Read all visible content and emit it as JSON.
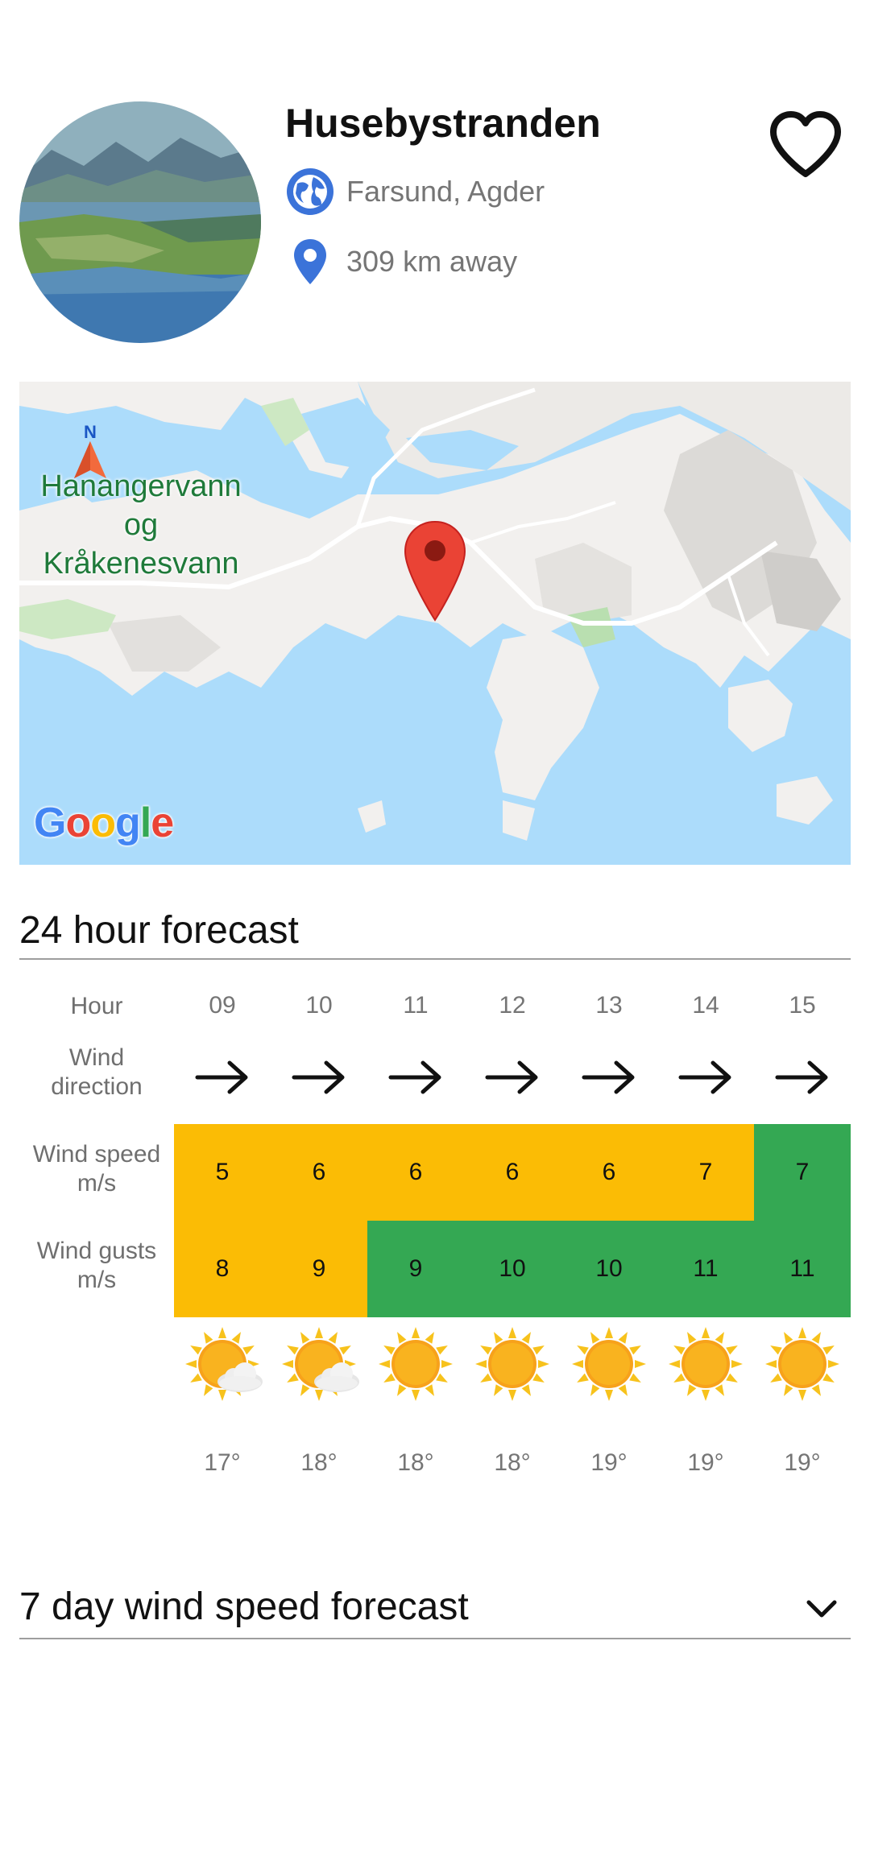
{
  "header": {
    "title": "Husebystranden",
    "location": "Farsund, Agder",
    "distance": "309 km away"
  },
  "map": {
    "place_label_lines": [
      "Hanangervann",
      "og",
      "Kråkenesvann"
    ],
    "north_label": "N",
    "google_letters": [
      {
        "ch": "G",
        "color": "#4285F4"
      },
      {
        "ch": "o",
        "color": "#EA4335"
      },
      {
        "ch": "o",
        "color": "#FBBC05"
      },
      {
        "ch": "g",
        "color": "#4285F4"
      },
      {
        "ch": "l",
        "color": "#34A853"
      },
      {
        "ch": "e",
        "color": "#EA4335"
      }
    ]
  },
  "forecast24": {
    "title": "24 hour forecast",
    "labels": {
      "hour": "Hour",
      "wind_direction": [
        "Wind",
        "direction"
      ],
      "wind_speed": [
        "Wind speed",
        "m/s"
      ],
      "wind_gusts": [
        "Wind gusts",
        "m/s"
      ]
    },
    "hours": [
      "09",
      "10",
      "11",
      "12",
      "13",
      "14",
      "15"
    ],
    "wind_direction_icon": "arrow-right-icon",
    "wind_speed": [
      "5",
      "6",
      "6",
      "6",
      "6",
      "7",
      "7"
    ],
    "wind_speed_level": [
      "moderate",
      "moderate",
      "moderate",
      "moderate",
      "moderate",
      "moderate",
      "good"
    ],
    "wind_gusts": [
      "8",
      "9",
      "9",
      "10",
      "10",
      "11",
      "11"
    ],
    "wind_gusts_level": [
      "moderate",
      "moderate",
      "good",
      "good",
      "good",
      "good",
      "good"
    ],
    "weather_icons": [
      "partly-cloudy-icon",
      "partly-cloudy-icon",
      "sun-icon",
      "sun-icon",
      "sun-icon",
      "sun-icon",
      "sun-icon"
    ],
    "temperatures": [
      "17°",
      "18°",
      "18°",
      "18°",
      "19°",
      "19°",
      "19°"
    ],
    "colors": {
      "moderate": "#fbbc05",
      "good": "#34a853"
    }
  },
  "forecast7": {
    "title": "7 day wind speed forecast"
  }
}
